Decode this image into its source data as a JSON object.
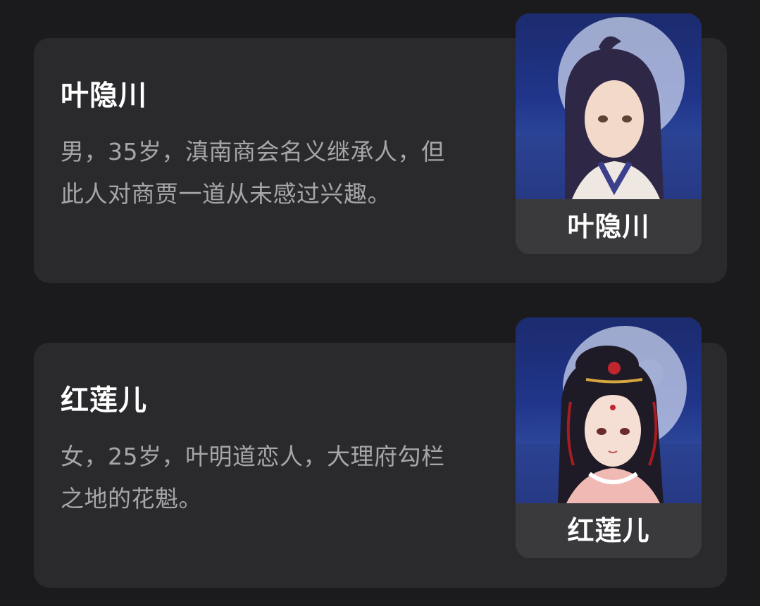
{
  "characters": [
    {
      "name": "叶隐川",
      "description_line1": "男，35岁，滇南商会名义继承人，但",
      "description_line2": "此人对商贾一道从未感过兴趣。",
      "avatar_label": "叶隐川"
    },
    {
      "name": "红莲儿",
      "description_line1": "女，25岁，叶明道恋人，大理府勾栏",
      "description_line2": "之地的花魁。",
      "avatar_label": "红莲儿"
    }
  ]
}
